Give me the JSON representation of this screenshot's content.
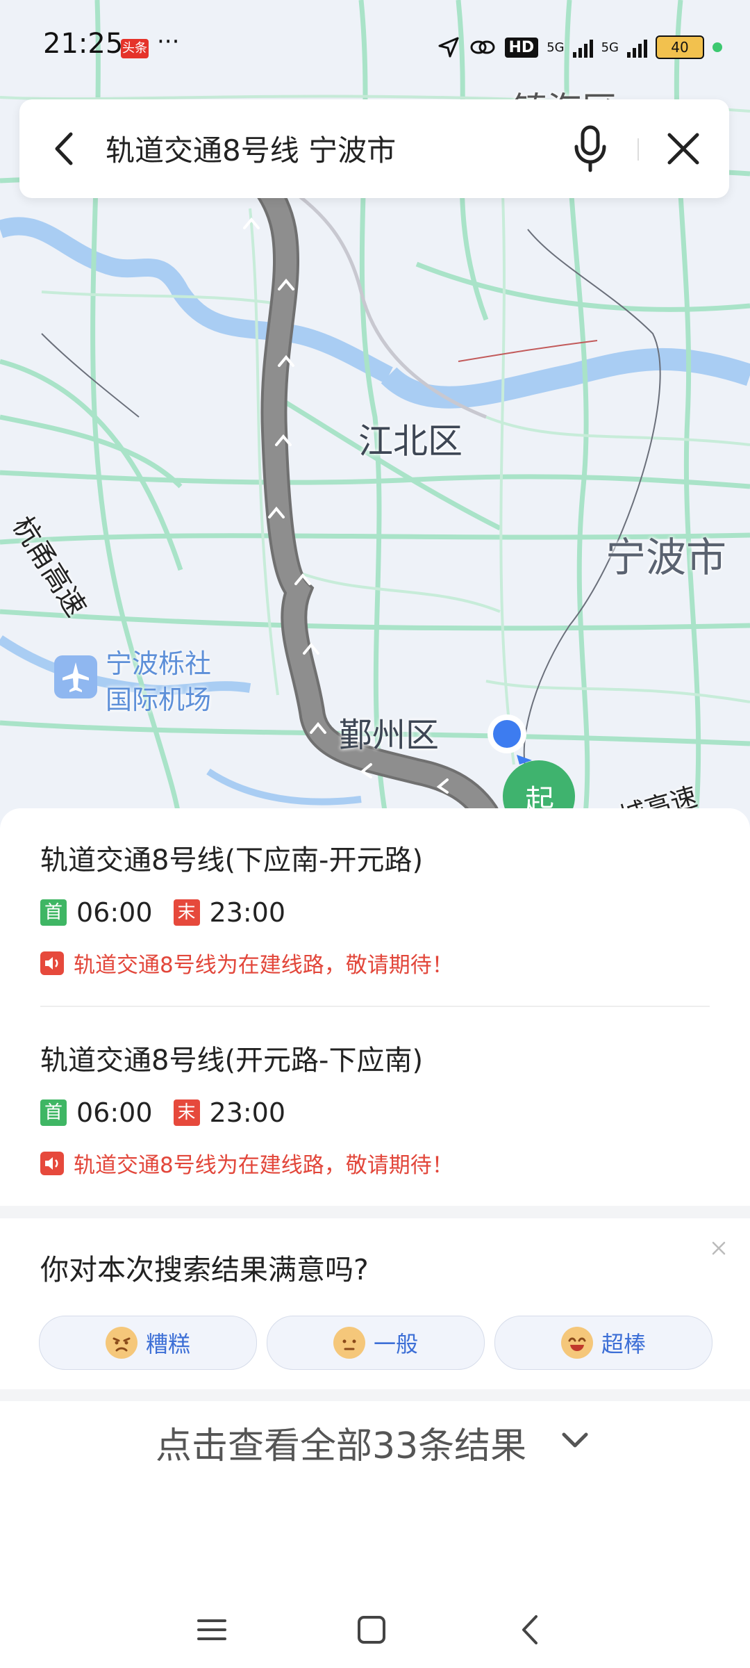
{
  "status_bar": {
    "time": "21:25",
    "news_badge": "头条",
    "more_dots": "···",
    "hd_label": "HD",
    "net1": "5G",
    "net2": "5G",
    "battery": "40"
  },
  "search": {
    "query": "轨道交通8号线 宁波市"
  },
  "map": {
    "labels": {
      "zhenhai": "镇海区",
      "jiangbei": "江北区",
      "ningbo": "宁波市",
      "yinzhou": "鄞州区",
      "airport_line1": "宁波栎社",
      "airport_line2": "国际机场",
      "hangyong": "杭甬高速",
      "highway_right": "城高速",
      "start": "起"
    }
  },
  "results": [
    {
      "title": "轨道交通8号线(下应南-开元路)",
      "first_badge": "首",
      "first_time": "06:00",
      "last_badge": "末",
      "last_time": "23:00",
      "notice": "轨道交通8号线为在建线路，敬请期待！"
    },
    {
      "title": "轨道交通8号线(开元路-下应南)",
      "first_badge": "首",
      "first_time": "06:00",
      "last_badge": "末",
      "last_time": "23:00",
      "notice": "轨道交通8号线为在建线路，敬请期待！"
    }
  ],
  "feedback": {
    "question": "你对本次搜索结果满意吗?",
    "options": [
      "糟糕",
      "一般",
      "超棒"
    ]
  },
  "more": {
    "label": "点击查看全部33条结果"
  },
  "colors": {
    "route": "#8e8e8e",
    "road": "#a9e3c8",
    "river": "#a9cdf3",
    "start_marker": "#3fb36e",
    "location_dot": "#3d7cf0",
    "notice_red": "#e2463a",
    "link_blue": "#3d6fd6"
  }
}
